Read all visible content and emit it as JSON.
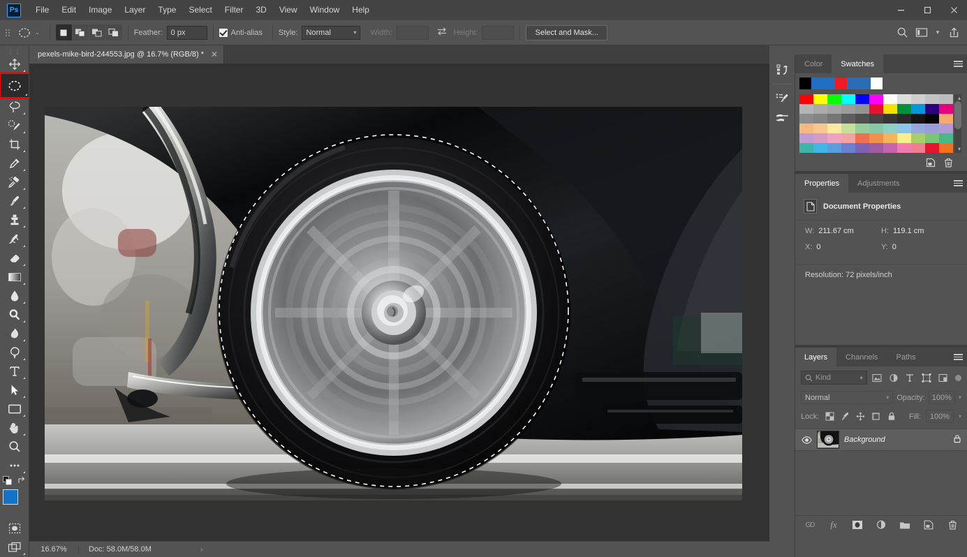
{
  "app": {
    "name": "Adobe Photoshop",
    "logo_text": "Ps",
    "accent_color": "#31a8ff"
  },
  "menubar": {
    "items": [
      {
        "label": "File"
      },
      {
        "label": "Edit"
      },
      {
        "label": "Image"
      },
      {
        "label": "Layer"
      },
      {
        "label": "Type"
      },
      {
        "label": "Select"
      },
      {
        "label": "Filter"
      },
      {
        "label": "3D"
      },
      {
        "label": "View"
      },
      {
        "label": "Window"
      },
      {
        "label": "Help"
      }
    ],
    "window_controls": {
      "minimize": "–",
      "maximize": "□",
      "close": "✕"
    }
  },
  "options_bar": {
    "active_tool": "elliptical-marquee-tool",
    "tool_preset_chevron": "⌄",
    "boolean_modes": [
      {
        "name": "new-selection",
        "active": true
      },
      {
        "name": "add-to-selection",
        "active": false
      },
      {
        "name": "subtract-from-selection",
        "active": false
      },
      {
        "name": "intersect-with-selection",
        "active": false
      }
    ],
    "feather_label": "Feather:",
    "feather_value": "0 px",
    "antialias_label": "Anti-alias",
    "antialias_checked": true,
    "style_label": "Style:",
    "style_value": "Normal",
    "width_label": "Width:",
    "width_value": "",
    "height_label": "Height:",
    "height_value": "",
    "swap_icon": "swap-width-height-icon",
    "select_and_mask": "Select and Mask...",
    "right_icons": [
      "search-icon",
      "arrange-documents-icon",
      "chevron-down-icon",
      "share-icon"
    ]
  },
  "document_tab": {
    "title": "pexels-mike-bird-244553.jpg @ 16.7% (RGB/8) *",
    "close_glyph": "✕"
  },
  "toolbar": {
    "tools": [
      {
        "name": "move-tool",
        "glyph": "move",
        "has_submenu": true,
        "highlighted": false
      },
      {
        "name": "elliptical-marquee-tool",
        "glyph": "ellipse-marquee",
        "has_submenu": true,
        "highlighted": true
      },
      {
        "name": "lasso-tool",
        "glyph": "lasso",
        "has_submenu": true,
        "highlighted": false
      },
      {
        "name": "object-selection-tool",
        "glyph": "quick-select",
        "has_submenu": true,
        "highlighted": false
      },
      {
        "name": "crop-tool",
        "glyph": "crop",
        "has_submenu": true,
        "highlighted": false
      },
      {
        "name": "eyedropper-tool",
        "glyph": "eyedropper",
        "has_submenu": true,
        "highlighted": false
      },
      {
        "name": "spot-healing-brush-tool",
        "glyph": "healing",
        "has_submenu": true,
        "highlighted": false
      },
      {
        "name": "brush-tool",
        "glyph": "brush",
        "has_submenu": true,
        "highlighted": false
      },
      {
        "name": "clone-stamp-tool",
        "glyph": "stamp",
        "has_submenu": true,
        "highlighted": false
      },
      {
        "name": "history-brush-tool",
        "glyph": "history-brush",
        "has_submenu": true,
        "highlighted": false
      },
      {
        "name": "eraser-tool",
        "glyph": "eraser",
        "has_submenu": true,
        "highlighted": false
      },
      {
        "name": "gradient-tool",
        "glyph": "gradient",
        "has_submenu": true,
        "highlighted": false
      },
      {
        "name": "blur-tool",
        "glyph": "blur",
        "has_submenu": true,
        "highlighted": false
      },
      {
        "name": "dodge-tool",
        "glyph": "dodge",
        "has_submenu": true,
        "highlighted": false
      },
      {
        "name": "burn-tool",
        "glyph": "burn",
        "has_submenu": true,
        "highlighted": false
      },
      {
        "name": "pen-tool",
        "glyph": "pen",
        "has_submenu": true,
        "highlighted": false
      },
      {
        "name": "horizontal-type-tool",
        "glyph": "type",
        "has_submenu": true,
        "highlighted": false
      },
      {
        "name": "path-selection-tool",
        "glyph": "path-select",
        "has_submenu": true,
        "highlighted": false
      },
      {
        "name": "rectangle-tool",
        "glyph": "rectangle",
        "has_submenu": true,
        "highlighted": false
      },
      {
        "name": "hand-tool",
        "glyph": "hand",
        "has_submenu": true,
        "highlighted": false
      },
      {
        "name": "zoom-tool",
        "glyph": "zoom",
        "has_submenu": false,
        "highlighted": false
      },
      {
        "name": "edit-toolbar-button",
        "glyph": "ellipsis",
        "has_submenu": true,
        "highlighted": false
      }
    ],
    "foreground_color": "#1473c8",
    "background_color": "#ffffff",
    "quick_mask_name": "quick-mask-mode",
    "screen_mode_name": "screen-mode"
  },
  "canvas": {
    "zoom_level": "16.67%",
    "selection": {
      "type": "ellipse",
      "style": "marching-ants-dashed"
    },
    "image_description": "Close-up of a black classic car's spinning chrome wheel on asphalt"
  },
  "statusbar": {
    "zoom": "16.67%",
    "doc_label": "Doc: 58.0M/58.0M",
    "expand_glyph": "›"
  },
  "icon_dock": {
    "icons": [
      {
        "name": "history-panel-icon"
      },
      {
        "name": "brush-presets-icon"
      },
      {
        "name": "brush-settings-icon"
      }
    ]
  },
  "swatches_panel": {
    "tabs": [
      {
        "label": "Color",
        "active": false
      },
      {
        "label": "Swatches",
        "active": true
      }
    ],
    "menu_icon": "panel-menu-icon",
    "recent_colors": [
      "#000000",
      "#1f6fc4",
      "#1f6fc4",
      "#ee1b22",
      "#2a6cb5",
      "#2a6cb5",
      "#ffffff"
    ],
    "grid_colors": [
      "#ff0000",
      "#ffff00",
      "#00ff00",
      "#00ffff",
      "#0000ff",
      "#ff00ff",
      "#fefefe",
      "#dcdcdc",
      "#cfcfcf",
      "#c2c2c2",
      "#bdbdbd",
      "#b5b5b5",
      "#ababab",
      "#a3a3a3",
      "#9b9b9b",
      "#939393",
      "#e8112d",
      "#f5e100",
      "#00903e",
      "#0098da",
      "#2d0080",
      "#e6007e",
      "#8c8c8c",
      "#848484",
      "#767676",
      "#5e5e5e",
      "#4f4f4f",
      "#434343",
      "#363636",
      "#2a2a2a",
      "#141414",
      "#050505",
      "#f6a96d",
      "#f5b87f",
      "#f7c88d",
      "#faeaa1",
      "#c5e09b",
      "#96cf9b",
      "#86c8a8",
      "#8fd0c4",
      "#8ec6ea",
      "#96a8dd",
      "#9b9ddb",
      "#b09ad4",
      "#bf9cd2",
      "#d49bc5",
      "#eda3bf",
      "#f2a3a0",
      "#ef7051",
      "#f0904a",
      "#f3b45e",
      "#f9ee89",
      "#a8ce6b",
      "#7cc377",
      "#4bb686",
      "#3eb5a8",
      "#41b6e6",
      "#5b9ede",
      "#6b7fd0",
      "#7f62b2",
      "#a25ba0",
      "#c665ad",
      "#ef7cad",
      "#ef7f8c",
      "#e6142d",
      "#ee7221",
      "#f29400",
      "#f6e500",
      "#7fbf3f",
      "#00a651",
      "#009b4e",
      "#00a79d",
      "#00b5ef",
      "#0e64ad",
      "#1b2f8e",
      "#4e1787",
      "#7e2a8e",
      "#cd2a8f",
      "#e7006d",
      "#d80029",
      "#b5001f",
      "#b85c16",
      "#c98a00",
      "#b8b400"
    ],
    "scroll_up_glyph": "▴",
    "scroll_down_glyph": "▾",
    "footer_icons": [
      {
        "name": "new-swatch-icon"
      },
      {
        "name": "delete-swatch-icon"
      }
    ]
  },
  "properties_panel": {
    "tabs": [
      {
        "label": "Properties",
        "active": true
      },
      {
        "label": "Adjustments",
        "active": false
      }
    ],
    "menu_icon": "panel-menu-icon",
    "section_title": "Document Properties",
    "section_icon": "document-icon",
    "fields": [
      {
        "key": "W:",
        "value": "211.67 cm"
      },
      {
        "key": "H:",
        "value": "119.1 cm"
      },
      {
        "key": "X:",
        "value": "0"
      },
      {
        "key": "Y:",
        "value": "0"
      }
    ],
    "resolution": "Resolution: 72 pixels/inch"
  },
  "layers_panel": {
    "tabs": [
      {
        "label": "Layers",
        "active": true
      },
      {
        "label": "Channels",
        "active": false
      },
      {
        "label": "Paths",
        "active": false
      }
    ],
    "menu_icon": "panel-menu-icon",
    "filter": {
      "kind_label": "Kind",
      "search_icon": "search-icon",
      "chevron": "⌄",
      "type_filters": [
        {
          "name": "filter-pixel-layers-icon"
        },
        {
          "name": "filter-adjustment-layers-icon"
        },
        {
          "name": "filter-type-layers-icon"
        },
        {
          "name": "filter-shape-layers-icon"
        },
        {
          "name": "filter-smart-objects-icon"
        }
      ],
      "toggle_name": "filter-toggle-switch"
    },
    "blend_mode": "Normal",
    "opacity_label": "Opacity:",
    "opacity_value": "100%",
    "lock_label": "Lock:",
    "lock_icons": [
      {
        "name": "lock-transparent-pixels-icon"
      },
      {
        "name": "lock-image-pixels-icon"
      },
      {
        "name": "lock-position-icon"
      },
      {
        "name": "lock-artboard-nesting-icon"
      },
      {
        "name": "lock-all-icon"
      }
    ],
    "fill_label": "Fill:",
    "fill_value": "100%",
    "layers": [
      {
        "name": "Background",
        "visible": true,
        "locked": true,
        "eye_icon": "eye-icon",
        "lock_icon": "lock-icon"
      }
    ],
    "footer_icons": [
      {
        "name": "link-layers-icon",
        "label": "GD"
      },
      {
        "name": "layer-style-icon",
        "label": "fx"
      },
      {
        "name": "add-layer-mask-icon",
        "label": ""
      },
      {
        "name": "new-adjustment-layer-icon",
        "label": ""
      },
      {
        "name": "new-group-icon",
        "label": ""
      },
      {
        "name": "new-layer-icon",
        "label": ""
      },
      {
        "name": "delete-layer-icon",
        "label": ""
      }
    ]
  }
}
